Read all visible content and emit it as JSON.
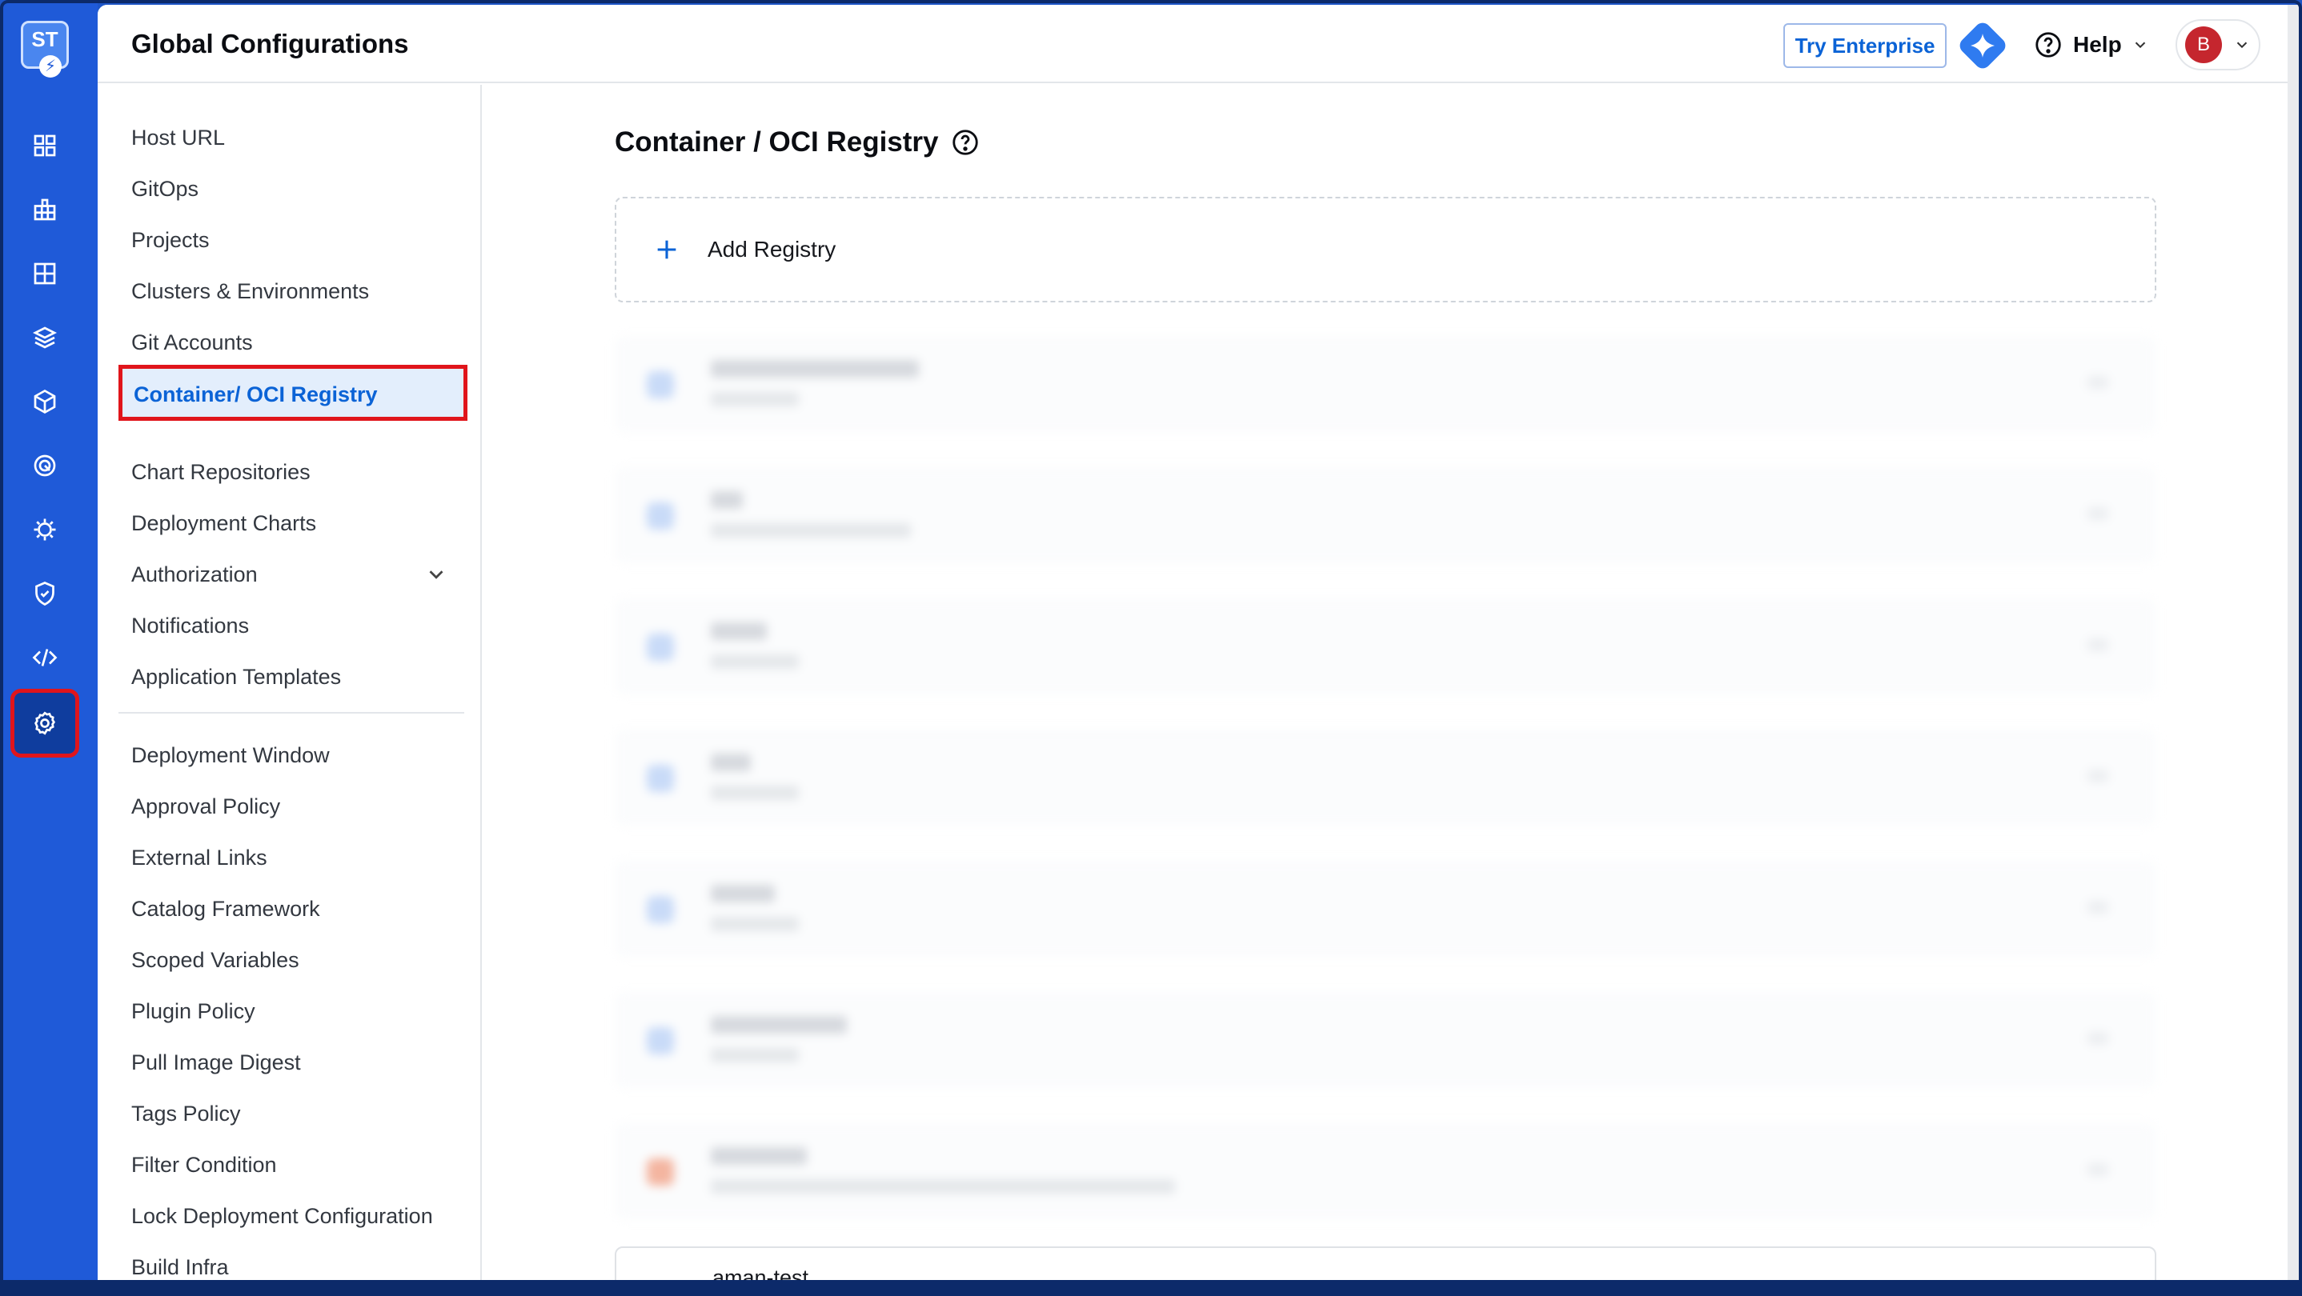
{
  "rail": {
    "logo_text": "ST",
    "icons": [
      "overview-icon",
      "applications-icon",
      "app-groups-icon",
      "jobs-icon",
      "resource-browser-icon",
      "security-icon-target",
      "bug-icon",
      "shield-icon",
      "code-icon",
      "settings-gear-icon"
    ]
  },
  "header": {
    "title": "Global Configurations",
    "try_enterprise": "Try Enterprise",
    "help": "Help",
    "avatar_initial": "B"
  },
  "sidebar": {
    "group1": [
      "Host URL",
      "GitOps",
      "Projects",
      "Clusters & Environments",
      "Git Accounts"
    ],
    "selected": "Container/ OCI Registry",
    "group2": [
      "Chart Repositories",
      "Deployment Charts",
      "Authorization",
      "Notifications",
      "Application Templates"
    ],
    "group3": [
      "Deployment Window",
      "Approval Policy",
      "External Links",
      "Catalog Framework",
      "Scoped Variables",
      "Plugin Policy",
      "Pull Image Digest",
      "Tags Policy",
      "Filter Condition",
      "Lock Deployment Configuration",
      "Build Infra"
    ]
  },
  "content": {
    "title": "Container / OCI Registry",
    "add_registry": "Add Registry",
    "last_registry_name": "aman-test"
  },
  "colors": {
    "rail": "#1f5ad8",
    "accent": "#0b63d6",
    "highlight_border": "#e0151b",
    "selected_bg": "#e3eefc"
  }
}
